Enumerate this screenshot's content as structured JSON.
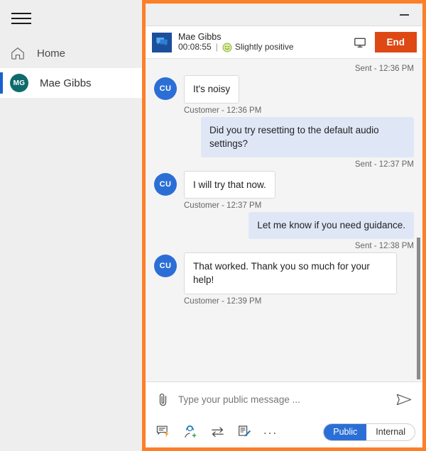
{
  "theme": {
    "highlight": "#fc7f29",
    "accent_blue": "#2b6fd6",
    "end_red": "#dd4814",
    "avatar_teal": "#0f6b6b",
    "conv_icon_blue": "#1b4f9c",
    "agent_bubble": "#dfe7f7"
  },
  "sidebar": {
    "menu_icon": "hamburger-icon",
    "items": [
      {
        "label": "Home",
        "icon": "home-icon",
        "selected": false
      },
      {
        "label": "Mae Gibbs",
        "icon": "avatar",
        "initials": "MG",
        "selected": true
      }
    ]
  },
  "window": {
    "minimize_label": "Minimize",
    "minimize_icon": "minimize-icon"
  },
  "conversation": {
    "icon": "chat-bubble-icon",
    "name": "Mae Gibbs",
    "timer": "00:08:55",
    "separator": "|",
    "sentiment_icon": "smiley-face-icon",
    "sentiment": "Slightly positive",
    "monitor_icon": "monitor-icon",
    "end_label": "End"
  },
  "messages": [
    {
      "direction": "out",
      "stamp": "Sent - 12:36 PM",
      "stamp_position": "above",
      "text": null
    },
    {
      "direction": "in",
      "initials": "CU",
      "text": "It's noisy",
      "stamp": "Customer - 12:36 PM"
    },
    {
      "direction": "out",
      "text": "Did you try resetting to the default audio settings?",
      "stamp": "Sent - 12:37 PM"
    },
    {
      "direction": "in",
      "initials": "CU",
      "text": "I will try that now.",
      "stamp": "Customer - 12:37 PM"
    },
    {
      "direction": "out",
      "text": "Let me know if you need guidance.",
      "stamp": "Sent - 12:38 PM"
    },
    {
      "direction": "in",
      "initials": "CU",
      "text": "That worked. Thank you so much for your help!",
      "stamp": "Customer - 12:39 PM"
    }
  ],
  "composer": {
    "attach_icon": "paperclip-icon",
    "placeholder": "Type your public message ...",
    "value": "",
    "send_icon": "send-icon",
    "tools": [
      {
        "name": "quick-reply-icon",
        "label": "Quick reply"
      },
      {
        "name": "add-agent-icon",
        "label": "Add agent"
      },
      {
        "name": "transfer-icon",
        "label": "Transfer"
      },
      {
        "name": "note-icon",
        "label": "Note"
      },
      {
        "name": "more-icon",
        "label": "..."
      }
    ],
    "visibility": {
      "public_label": "Public",
      "internal_label": "Internal",
      "selected": "Public"
    }
  }
}
